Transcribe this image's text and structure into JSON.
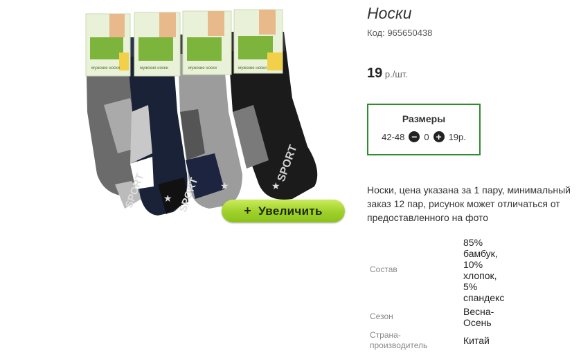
{
  "product": {
    "title": "Носки",
    "code": "Код: 965650438",
    "price_value": "19",
    "price_unit": "р./шт.",
    "zoom_label": "Увеличить",
    "zoom_plus": "+",
    "description": "Носки, цена указана за 1 пару, минимальный заказ 12 пар, рисунок может отличаться от предоставленного на фото"
  },
  "sizes": {
    "header": "Размеры",
    "size": "42-48",
    "quantity": "0",
    "price": "19р."
  },
  "specs": [
    {
      "label": "Состав",
      "value": "85% бамбук, 10% хлопок, 5% спандекс"
    },
    {
      "label": "Сезон",
      "value": "Весна-Осень"
    },
    {
      "label": "Страна-производитель",
      "value": "Китай"
    }
  ],
  "image_text": {
    "sport": "SPORT",
    "card_text": "мужские носки"
  },
  "colors": {
    "accent_green": "#2e8b2e",
    "button_green": "#9fd02a"
  }
}
